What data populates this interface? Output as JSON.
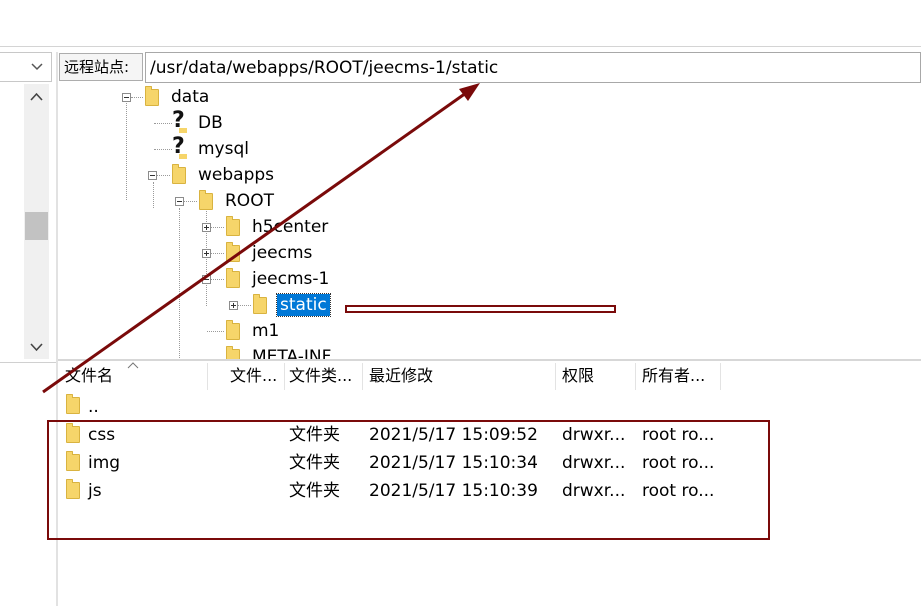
{
  "remote_site": {
    "label": "远程站点:",
    "path": "/usr/data/webapps/ROOT/jeecms-1/static"
  },
  "left_pane": {
    "dropdown_arrow": "chevron-down-icon"
  },
  "tree": {
    "items": [
      {
        "label": "data"
      },
      {
        "label": "DB"
      },
      {
        "label": "mysql"
      },
      {
        "label": "webapps"
      },
      {
        "label": "ROOT"
      },
      {
        "label": "h5center"
      },
      {
        "label": "jeecms"
      },
      {
        "label": "jeecms-1"
      },
      {
        "label": "static"
      },
      {
        "label": "m1"
      },
      {
        "label": "META-INF"
      }
    ]
  },
  "file_list": {
    "columns": [
      "文件名",
      "文件...",
      "文件类...",
      "最近修改",
      "权限",
      "所有者..."
    ],
    "parent_row": {
      "name": ".."
    },
    "rows": [
      {
        "name": "css",
        "type": "文件夹",
        "modified": "2021/5/17 15:09:52",
        "perms": "drwxr...",
        "owner": "root ro..."
      },
      {
        "name": "img",
        "type": "文件夹",
        "modified": "2021/5/17 15:10:34",
        "perms": "drwxr...",
        "owner": "root ro..."
      },
      {
        "name": "js",
        "type": "文件夹",
        "modified": "2021/5/17 15:10:39",
        "perms": "drwxr...",
        "owner": "root ro..."
      }
    ]
  },
  "annotation_colors": {
    "dark_red": "#7a0a0a",
    "selection": "#0078d7"
  }
}
